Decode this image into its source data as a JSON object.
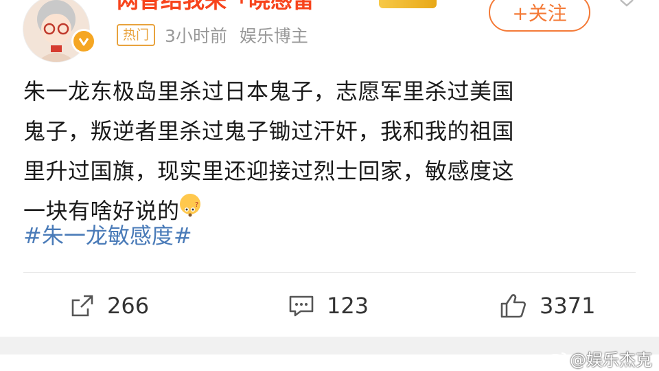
{
  "post": {
    "username": "网昏结我来「晓感雷",
    "hot_tag": "热门",
    "time": "3小时前",
    "role": "娱乐博主",
    "follow_label": "+关注",
    "content_lines": [
      "朱一龙东极岛里杀过日本鬼子，志愿军里杀过美国",
      "鬼子，叛逆者里杀过鬼子锄过汗奸，我和我的祖国",
      "里升过国旗，现实里还迎接过烈士回家，敏感度这",
      "一块有啥好说的"
    ],
    "hashtag": "#朱一龙敏感度#"
  },
  "actions": {
    "repost_count": "266",
    "comment_count": "123",
    "like_count": "3371"
  },
  "watermark": "@娱乐杰克",
  "colors": {
    "username": "#f7441c",
    "follow": "#f47a37",
    "hot_tag": "#e8a23c",
    "hashtag": "#4a7bb8",
    "meta": "#999999"
  },
  "icons": [
    "avatar",
    "verified-icon",
    "vip-badge",
    "more-chevron-icon",
    "thinking-emoji",
    "repost-icon",
    "comment-icon",
    "like-icon",
    "weibo-logo-icon"
  ]
}
